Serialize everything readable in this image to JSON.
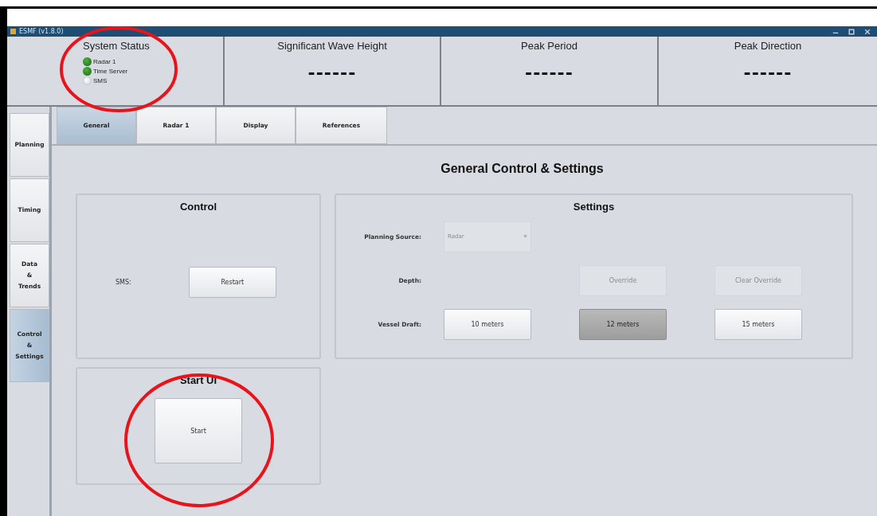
{
  "window": {
    "title": "ESMF (v1.8.0)"
  },
  "status": {
    "title": "System Status",
    "highlighted": true,
    "items": [
      {
        "label": "Radar 1",
        "on": true
      },
      {
        "label": "Time Server",
        "on": true
      },
      {
        "label": "SMS",
        "on": false
      }
    ]
  },
  "readouts": [
    {
      "title": "Significant Wave Height",
      "value": "------"
    },
    {
      "title": "Peak Period",
      "value": "------"
    },
    {
      "title": "Peak Direction",
      "value": "------"
    }
  ],
  "sidebar": {
    "items": [
      {
        "label": "Planning",
        "selected": false
      },
      {
        "label": "Timing",
        "selected": false
      },
      {
        "label": "Data\n&\nTrends",
        "selected": false
      },
      {
        "label": "Control\n&\nSettings",
        "selected": true
      }
    ]
  },
  "tabs": [
    {
      "label": "General",
      "selected": true
    },
    {
      "label": "Radar 1",
      "selected": false
    },
    {
      "label": "Display",
      "selected": false
    },
    {
      "label": "References",
      "selected": false
    }
  ],
  "heading": "General Control & Settings",
  "control": {
    "title": "Control",
    "label": "SMS:",
    "button": "Restart"
  },
  "start": {
    "title": "Start UI",
    "button": "Start",
    "highlighted": true
  },
  "settings": {
    "title": "Settings",
    "rows": [
      {
        "label": "Planning Source:",
        "kind": "select",
        "value": "Radar",
        "disabled": true
      },
      {
        "label": "Depth:",
        "kind": "buttons",
        "buttons": [
          {
            "label": "Override",
            "disabled": true,
            "selected": false
          },
          {
            "label": "Clear Override",
            "disabled": true,
            "selected": false
          }
        ]
      },
      {
        "label": "Vessel Draft:",
        "kind": "buttons",
        "buttons": [
          {
            "label": "10 meters",
            "disabled": false,
            "selected": false
          },
          {
            "label": "12 meters",
            "disabled": false,
            "selected": true
          },
          {
            "label": "15 meters",
            "disabled": false,
            "selected": false
          }
        ]
      }
    ]
  }
}
